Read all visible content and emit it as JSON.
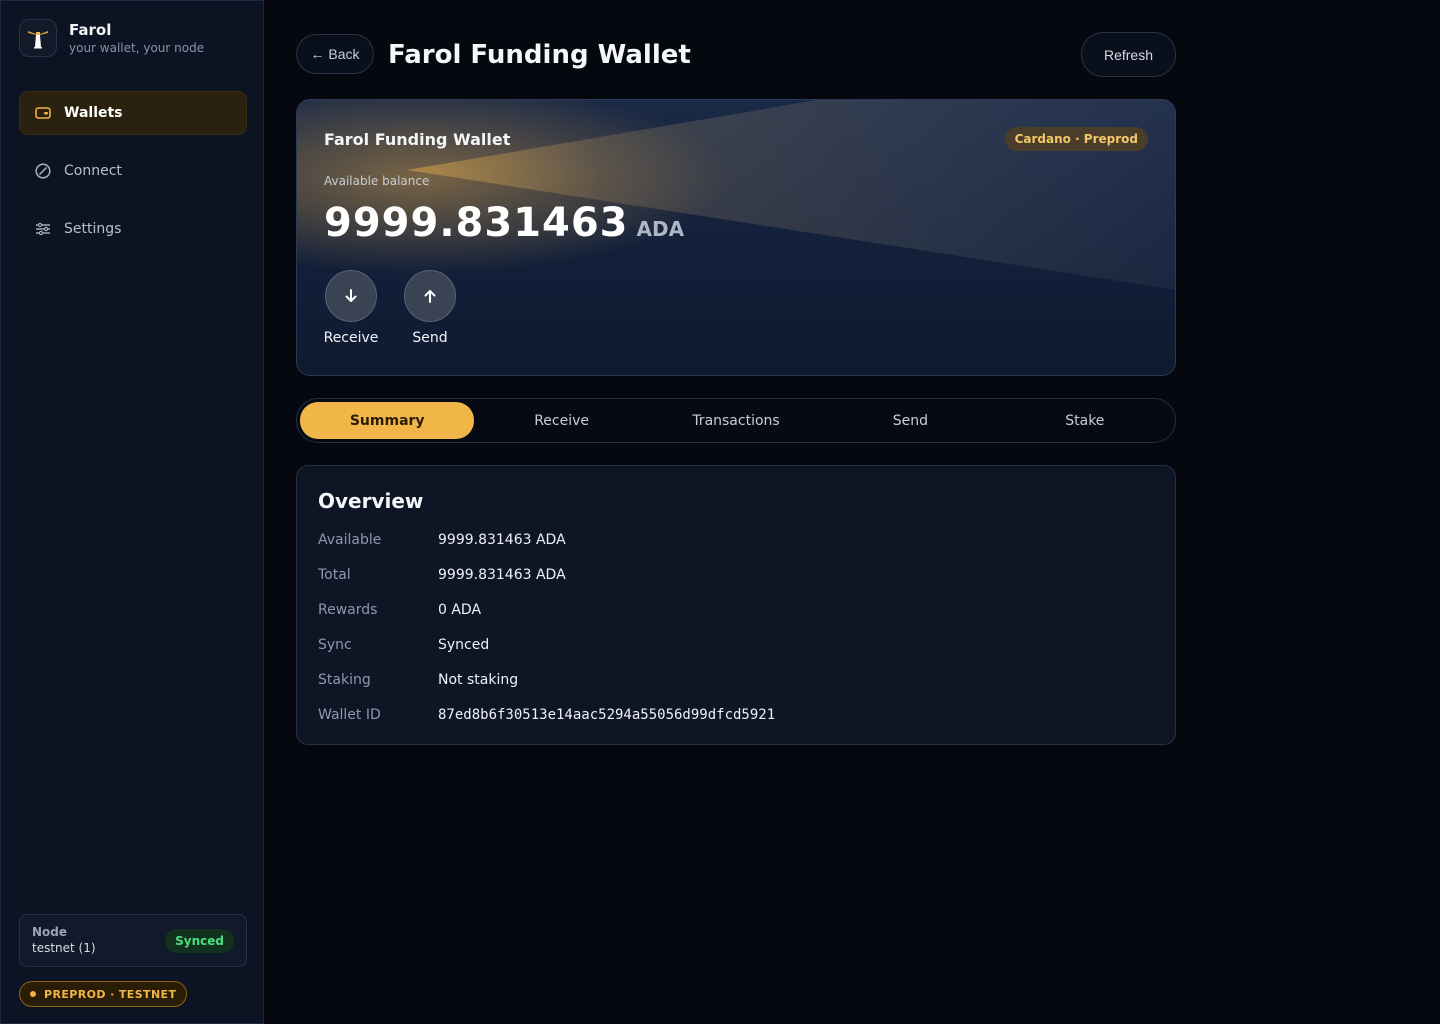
{
  "brand": {
    "name": "Farol",
    "tagline": "your wallet, your node",
    "logo_icon": "lighthouse-icon"
  },
  "sidebar": {
    "items": [
      {
        "label": "Wallets",
        "icon": "wallet-icon",
        "active": true
      },
      {
        "label": "Connect",
        "icon": "slash-circle-icon",
        "active": false
      },
      {
        "label": "Settings",
        "icon": "sliders-icon",
        "active": false
      }
    ],
    "node": {
      "title": "Node",
      "value": "testnet (1)",
      "status": "Synced"
    },
    "network_badge": "PREPROD · TESTNET"
  },
  "header": {
    "back_label": "← Back",
    "title": "Farol Funding Wallet",
    "refresh_label": "Refresh"
  },
  "balance_card": {
    "wallet_name": "Farol Funding Wallet",
    "chain": "Cardano · Preprod",
    "balance_label": "Available balance",
    "balance": "9999.831463",
    "unit": "ADA",
    "actions": {
      "receive": "Receive",
      "send": "Send"
    }
  },
  "tabs": [
    {
      "label": "Summary",
      "active": true
    },
    {
      "label": "Receive",
      "active": false
    },
    {
      "label": "Transactions",
      "active": false
    },
    {
      "label": "Send",
      "active": false
    },
    {
      "label": "Stake",
      "active": false
    }
  ],
  "overview": {
    "title": "Overview",
    "rows": [
      {
        "label": "Available",
        "value": "9999.831463 ADA"
      },
      {
        "label": "Total",
        "value": "9999.831463 ADA"
      },
      {
        "label": "Rewards",
        "value": "0 ADA"
      },
      {
        "label": "Sync",
        "value": "Synced"
      },
      {
        "label": "Staking",
        "value": "Not staking"
      },
      {
        "label": "Wallet ID",
        "value": "87ed8b6f30513e14aac5294a55056d99dfcd5921"
      }
    ]
  },
  "colors": {
    "accent": "#f1b648",
    "background": "#05080f",
    "sidebar": "#0c1322",
    "success": "#4ade80"
  }
}
